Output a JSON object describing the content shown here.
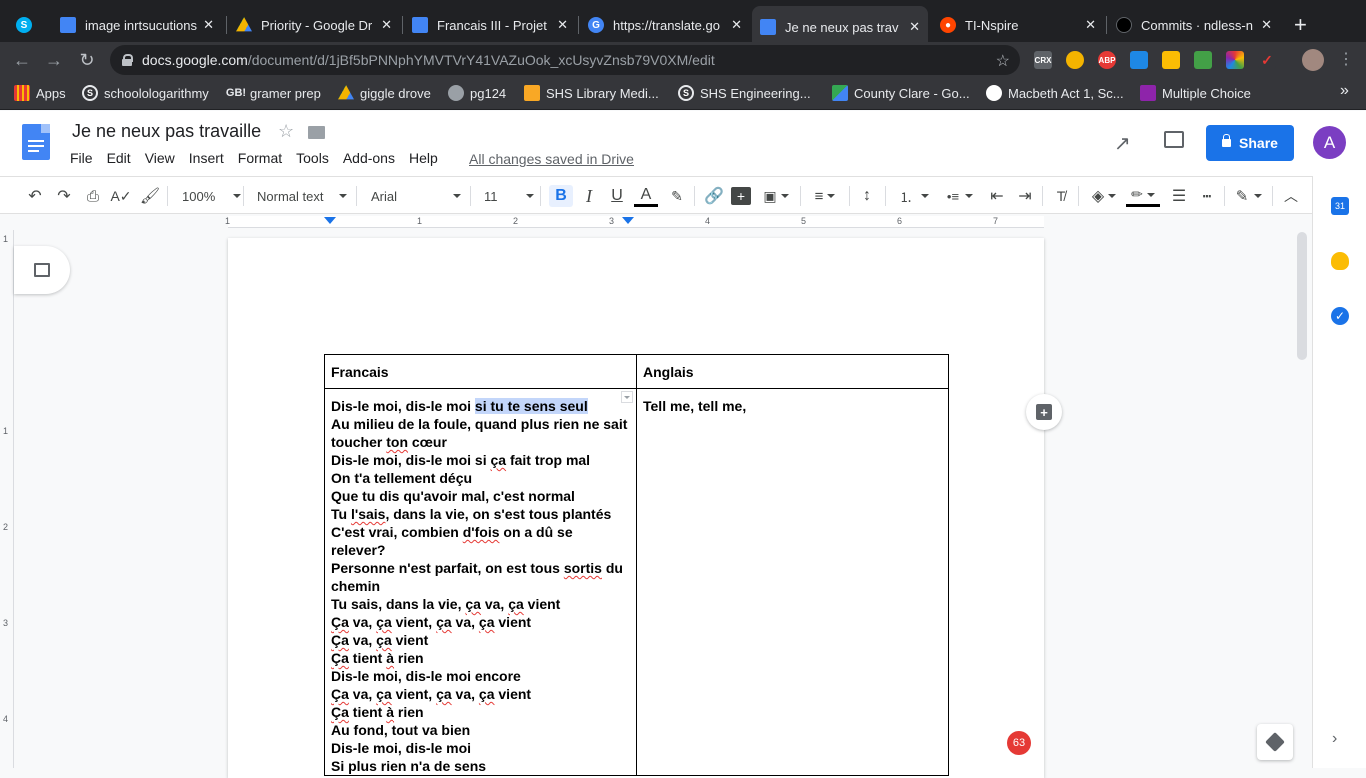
{
  "browser": {
    "tabs": [
      {
        "title": "",
        "icon": "skype-icon"
      },
      {
        "title": "image inrtsucutions",
        "icon": "google-docs-icon"
      },
      {
        "title": "Priority - Google Dr",
        "icon": "google-drive-icon"
      },
      {
        "title": "Francais III - Projet",
        "icon": "google-docs-icon"
      },
      {
        "title": "https://translate.go",
        "icon": "google-translate-icon"
      },
      {
        "title": "Je ne neux pas trav",
        "icon": "google-docs-icon",
        "active": true
      },
      {
        "title": "TI-Nspire",
        "icon": "reddit-icon"
      },
      {
        "title": "Commits · ndless-n",
        "icon": "github-icon"
      }
    ],
    "new_tab": "+",
    "url_host": "docs.google.com",
    "url_path": "/document/d/1jBf5bPNNphYMVTVrY41VAZuOok_xcUsyvZnsb79V0XM/edit",
    "bookmarks": [
      {
        "label": "Apps",
        "icon": "apps-grid-icon"
      },
      {
        "label": "schoolologarithmy",
        "icon": "schoology-icon"
      },
      {
        "label": "gramer prep",
        "icon": "gb-icon"
      },
      {
        "label": "giggle drove",
        "icon": "google-drive-icon"
      },
      {
        "label": "pg124",
        "icon": "globe-icon"
      },
      {
        "label": "SHS Library Medi...",
        "icon": "library-icon"
      },
      {
        "label": "SHS Engineering...",
        "icon": "schoology-icon"
      },
      {
        "label": "County Clare - Go...",
        "icon": "maps-icon"
      },
      {
        "label": "Macbeth Act 1, Sc...",
        "icon": "quiz-icon"
      },
      {
        "label": "Multiple Choice",
        "icon": "quiz-icon"
      }
    ],
    "extensions": [
      "CRX",
      "ABP"
    ],
    "more": "»"
  },
  "docs": {
    "title": "Je ne neux pas travaille",
    "menu": [
      "File",
      "Edit",
      "View",
      "Insert",
      "Format",
      "Tools",
      "Add-ons",
      "Help"
    ],
    "saved_status": "All changes saved in Drive",
    "share_label": "Share",
    "avatar_initial": "A",
    "toolbar": {
      "zoom": "100%",
      "style": "Normal text",
      "font": "Arial",
      "size": "11",
      "bold": "B",
      "italic": "I",
      "underline": "U",
      "text_color": "A"
    },
    "ruler_h": [
      "1",
      "1",
      "2",
      "3",
      "4",
      "5",
      "6",
      "7"
    ],
    "ruler_v": [
      "1",
      "1",
      "2",
      "3",
      "4"
    ],
    "notification_count": "63"
  },
  "table": {
    "headers": [
      "Francais",
      "Anglais"
    ],
    "francais_lines": [
      {
        "segments": [
          {
            "t": "Dis-le moi, dis-le moi "
          },
          {
            "t": "si tu te sens seul ",
            "hl": true
          }
        ]
      },
      {
        "segments": [
          {
            "t": "Au milieu de la foule, quand plus rien ne sait toucher "
          },
          {
            "t": "ton",
            "sq": true
          },
          {
            "t": " cœur"
          }
        ],
        "wrap": true
      },
      {
        "segments": [
          {
            "t": "Dis-le moi, dis-le moi si "
          },
          {
            "t": "ça",
            "sq": true
          },
          {
            "t": " fait trop mal"
          }
        ]
      },
      {
        "segments": [
          {
            "t": "On t'a tellement déçu"
          }
        ]
      },
      {
        "segments": [
          {
            "t": "Que tu dis qu'avoir mal, c'est normal"
          }
        ]
      },
      {
        "segments": [
          {
            "t": "Tu "
          },
          {
            "t": "l'sais",
            "sq": true
          },
          {
            "t": ", dans la vie, on s'est tous plantés"
          }
        ]
      },
      {
        "segments": [
          {
            "t": "C'est vrai, combien "
          },
          {
            "t": "d'fois",
            "sq": true
          },
          {
            "t": " on a dû se relever?"
          }
        ],
        "wrap": true
      },
      {
        "segments": [
          {
            "t": "Personne n'est parfait, on est tous "
          },
          {
            "t": "sortis",
            "sq": true
          },
          {
            "t": " du chemin"
          }
        ],
        "wrap": true
      },
      {
        "segments": [
          {
            "t": "Tu sais, dans la vie, "
          },
          {
            "t": "ça",
            "sq": true
          },
          {
            "t": " va, "
          },
          {
            "t": "ça",
            "sq": true
          },
          {
            "t": " vient"
          }
        ]
      },
      {
        "segments": [
          {
            "t": "Ça",
            "sq": true
          },
          {
            "t": " va, "
          },
          {
            "t": "ça",
            "sq": true
          },
          {
            "t": " vient, "
          },
          {
            "t": "ça",
            "sq": true
          },
          {
            "t": " va, "
          },
          {
            "t": "ça",
            "sq": true
          },
          {
            "t": " vient"
          }
        ]
      },
      {
        "segments": [
          {
            "t": "Ça",
            "sq": true
          },
          {
            "t": " va, "
          },
          {
            "t": "ça",
            "sq": true
          },
          {
            "t": " vient"
          }
        ]
      },
      {
        "segments": [
          {
            "t": "Ça",
            "sq": true
          },
          {
            "t": " tient "
          },
          {
            "t": "à",
            "sq": true
          },
          {
            "t": " rien"
          }
        ]
      },
      {
        "segments": [
          {
            "t": "Dis-le moi, dis-le moi encore"
          }
        ]
      },
      {
        "segments": [
          {
            "t": "Ça",
            "sq": true
          },
          {
            "t": " va, "
          },
          {
            "t": "ça",
            "sq": true
          },
          {
            "t": " vient, "
          },
          {
            "t": "ça",
            "sq": true
          },
          {
            "t": " va, "
          },
          {
            "t": "ça",
            "sq": true
          },
          {
            "t": " vient"
          }
        ]
      },
      {
        "segments": [
          {
            "t": "Ça",
            "sq": true
          },
          {
            "t": " tient "
          },
          {
            "t": "à",
            "sq": true
          },
          {
            "t": " rien"
          }
        ]
      },
      {
        "segments": [
          {
            "t": "Au fond, tout va bien"
          }
        ]
      },
      {
        "segments": [
          {
            "t": "Dis-le moi, dis-le moi"
          }
        ]
      },
      {
        "segments": [
          {
            "t": "Si plus rien n'a de sens"
          }
        ]
      }
    ],
    "anglais_lines": [
      "Tell me, tell me,"
    ]
  },
  "colors": {
    "accent": "#1a73e8",
    "highlight": "#c3d6fa",
    "spellcheck": "#e53935",
    "avatar": "#7b3ec2"
  }
}
